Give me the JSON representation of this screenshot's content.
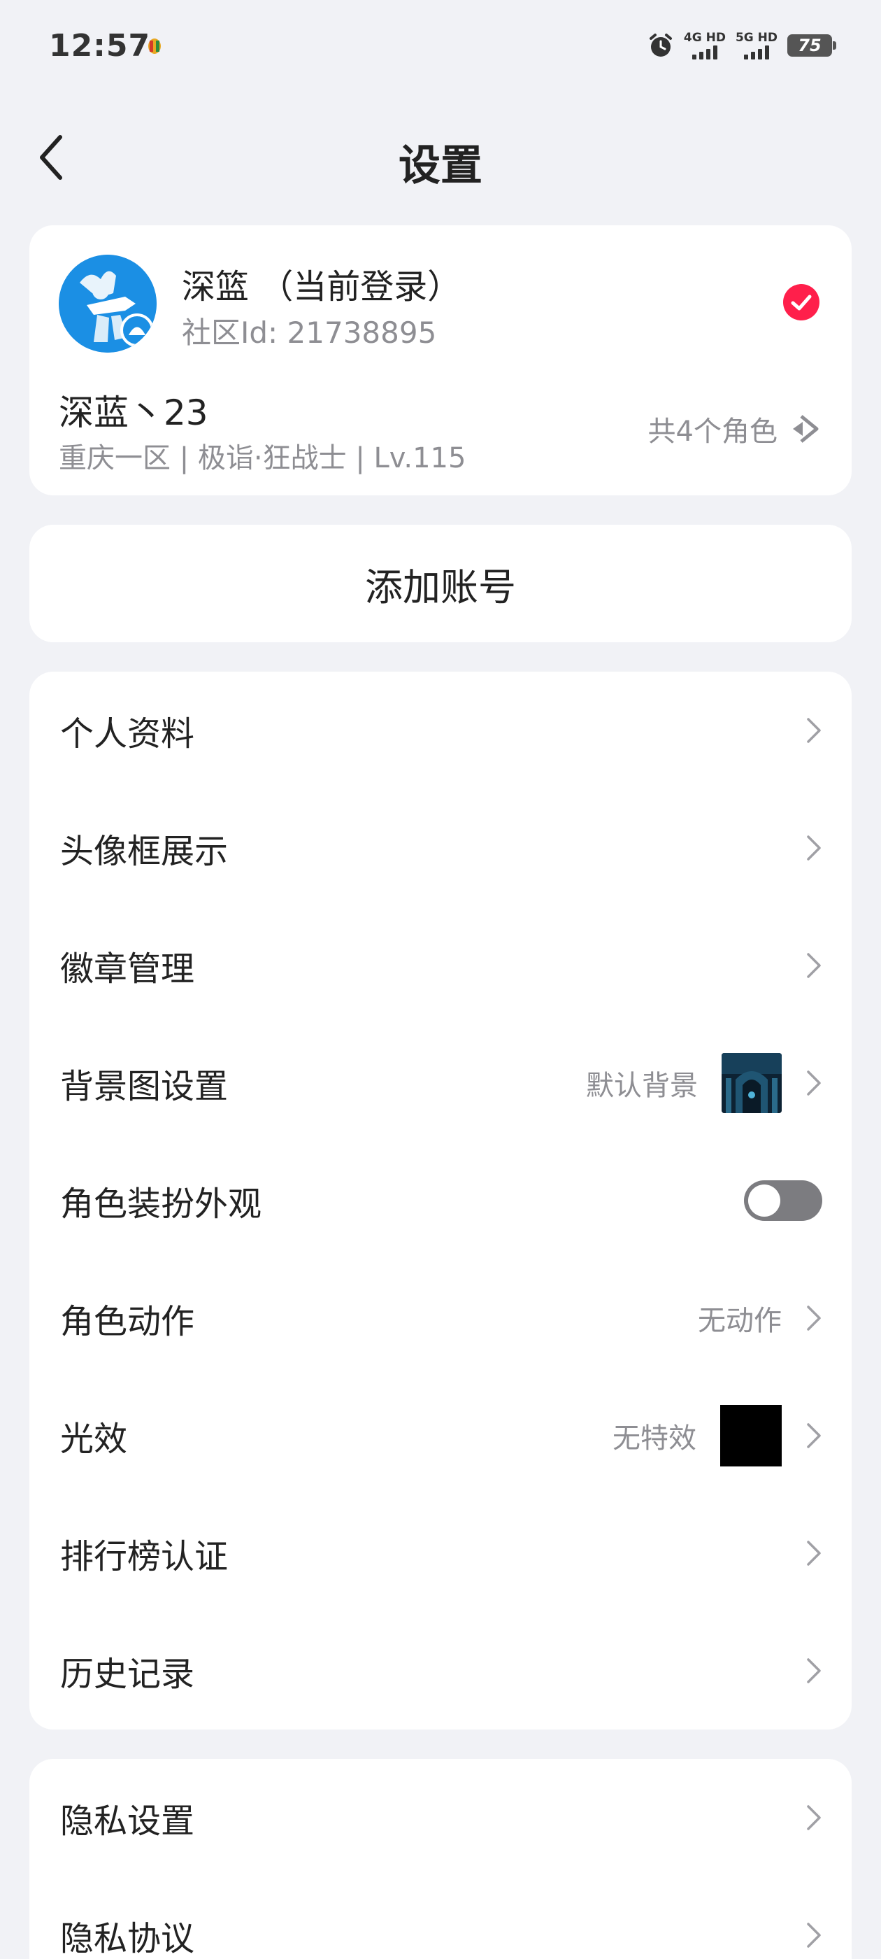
{
  "status_bar": {
    "time": "12:57",
    "signal_1": "4G HD",
    "signal_2": "5G HD",
    "battery": "75"
  },
  "header": {
    "title": "设置"
  },
  "account": {
    "name": "深篮 （当前登录）",
    "community_id": "社区Id: 21738895",
    "role_name": "深蓝丶23",
    "role_info": "重庆一区 | 极诣·狂战士 | Lv.115",
    "role_count": "共4个角色",
    "check_color": "#ff1f4b"
  },
  "add_account": {
    "label": "添加账号"
  },
  "menu": {
    "profile": {
      "label": "个人资料"
    },
    "avatar_frame": {
      "label": "头像框展示"
    },
    "badge": {
      "label": "徽章管理"
    },
    "background": {
      "label": "背景图设置",
      "value": "默认背景"
    },
    "outfit": {
      "label": "角色装扮外观",
      "enabled": false
    },
    "action": {
      "label": "角色动作",
      "value": "无动作"
    },
    "effect": {
      "label": "光效",
      "value": "无特效"
    },
    "ranking": {
      "label": "排行榜认证"
    },
    "history": {
      "label": "历史记录"
    }
  },
  "menu2": {
    "privacy_settings": {
      "label": "隐私设置"
    },
    "privacy_policy": {
      "label": "隐私协议"
    }
  }
}
